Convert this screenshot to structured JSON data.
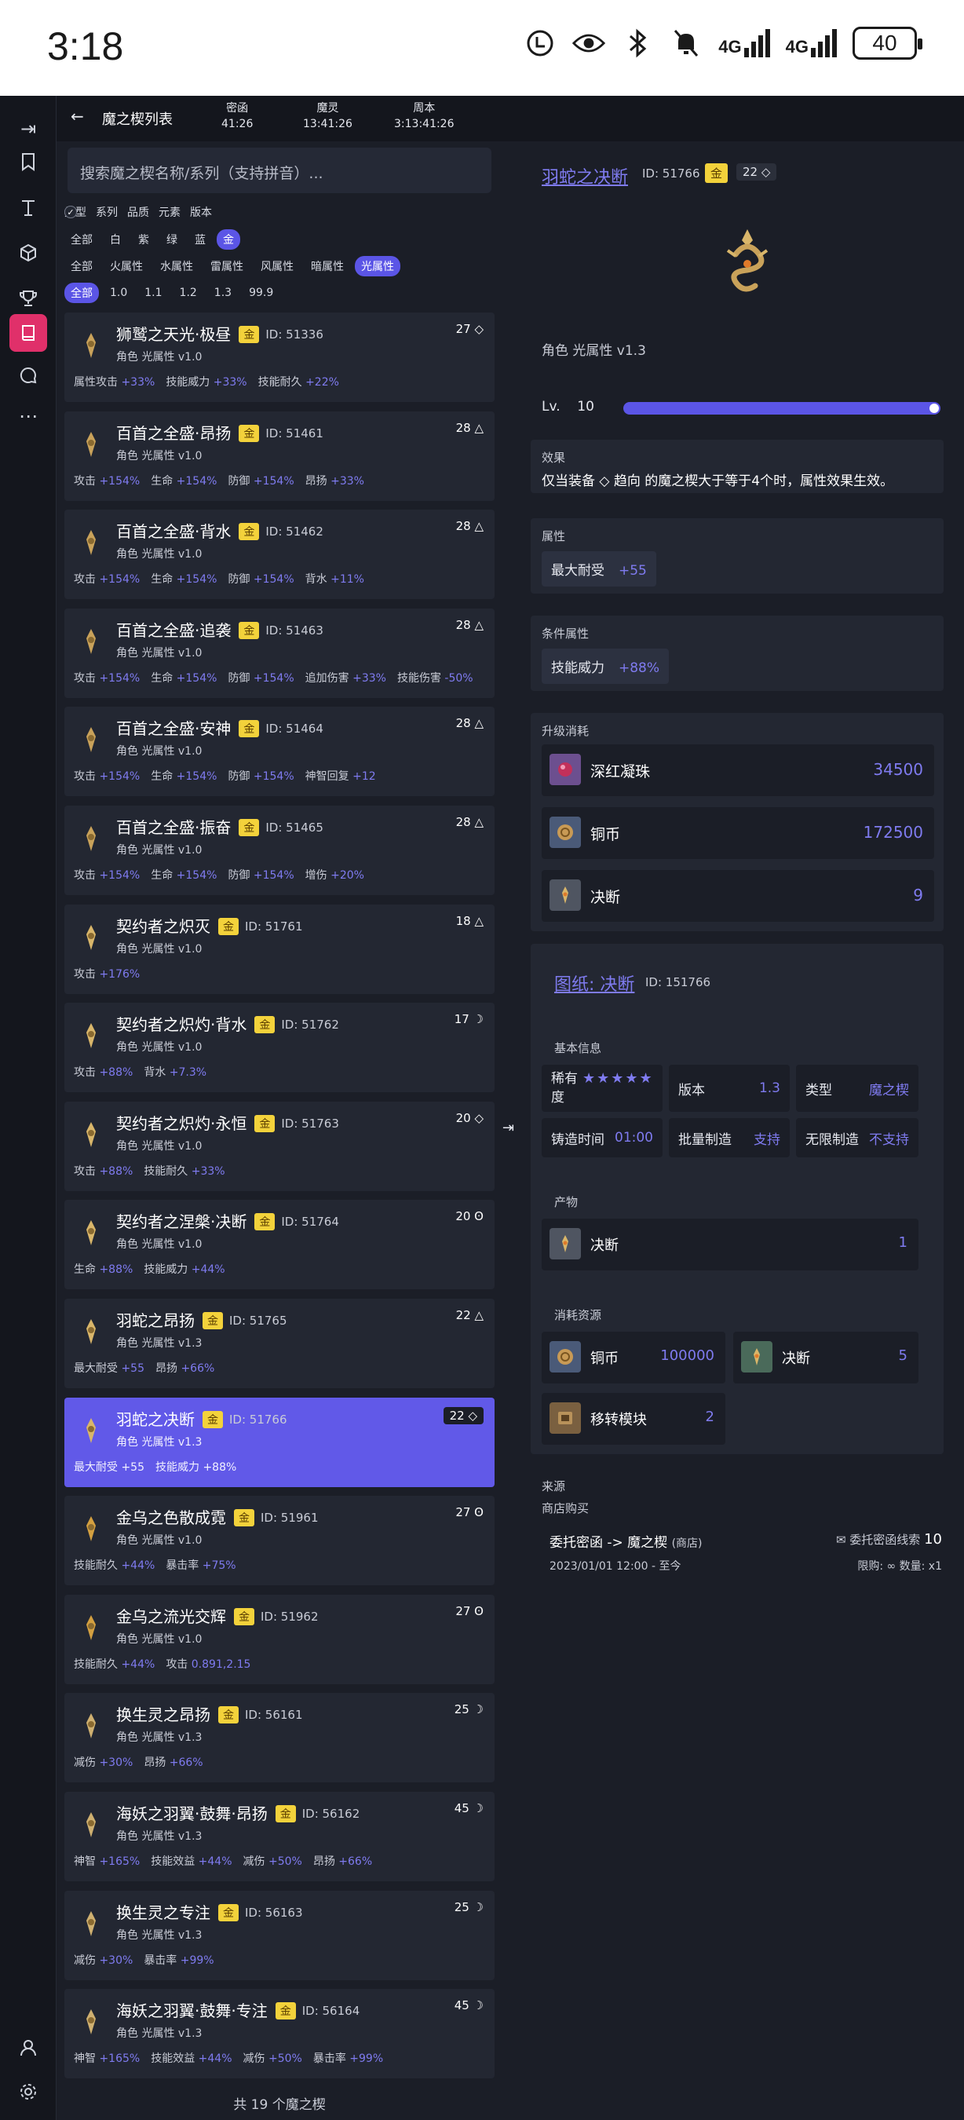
{
  "status": {
    "time": "3:18",
    "signal1": "4G",
    "signal2": "4G",
    "battery": "40"
  },
  "header": {
    "title": "魔之楔列表",
    "stats": [
      {
        "label": "密函",
        "value": "41:26"
      },
      {
        "label": "魔灵",
        "value": "13:41:26"
      },
      {
        "label": "周本",
        "value": "3:13:41:26"
      }
    ]
  },
  "search": {
    "placeholder": "搜索魔之楔名称/系列（支持拼音）..."
  },
  "filters": {
    "toggles": [
      "类型",
      "系列",
      "品质",
      "元素",
      "版本"
    ],
    "quality": [
      "全部",
      "白",
      "紫",
      "绿",
      "蓝",
      "金"
    ],
    "elements": [
      "全部",
      "火属性",
      "水属性",
      "雷属性",
      "风属性",
      "暗属性",
      "光属性"
    ],
    "versions": [
      "全部",
      "1.0",
      "1.1",
      "1.2",
      "1.3",
      "99.9"
    ]
  },
  "list": [
    {
      "name": "狮鹫之天光·极昼",
      "grade": "金",
      "id": "ID: 51336",
      "level": "27 ◇",
      "sub": "角色  光属性  v1.0",
      "stats": [
        [
          "属性攻击",
          "+33%"
        ],
        [
          "技能威力",
          "+33%"
        ],
        [
          "技能耐久",
          "+22%"
        ]
      ]
    },
    {
      "name": "百首之全盛·昂扬",
      "grade": "金",
      "id": "ID: 51461",
      "level": "28 △",
      "sub": "角色  光属性  v1.0",
      "stats": [
        [
          "攻击",
          "+154%"
        ],
        [
          "生命",
          "+154%"
        ],
        [
          "防御",
          "+154%"
        ],
        [
          "昂扬",
          "+33%"
        ]
      ]
    },
    {
      "name": "百首之全盛·背水",
      "grade": "金",
      "id": "ID: 51462",
      "level": "28 △",
      "sub": "角色  光属性  v1.0",
      "stats": [
        [
          "攻击",
          "+154%"
        ],
        [
          "生命",
          "+154%"
        ],
        [
          "防御",
          "+154%"
        ],
        [
          "背水",
          "+11%"
        ]
      ]
    },
    {
      "name": "百首之全盛·追袭",
      "grade": "金",
      "id": "ID: 51463",
      "level": "28 △",
      "sub": "角色  光属性  v1.0",
      "stats": [
        [
          "攻击",
          "+154%"
        ],
        [
          "生命",
          "+154%"
        ],
        [
          "防御",
          "+154%"
        ],
        [
          "追加伤害",
          "+33%"
        ],
        [
          "技能伤害",
          "-50%"
        ]
      ]
    },
    {
      "name": "百首之全盛·安神",
      "grade": "金",
      "id": "ID: 51464",
      "level": "28 △",
      "sub": "角色  光属性  v1.0",
      "stats": [
        [
          "攻击",
          "+154%"
        ],
        [
          "生命",
          "+154%"
        ],
        [
          "防御",
          "+154%"
        ],
        [
          "神智回复",
          "+12"
        ]
      ]
    },
    {
      "name": "百首之全盛·振奋",
      "grade": "金",
      "id": "ID: 51465",
      "level": "28 △",
      "sub": "角色  光属性  v1.0",
      "stats": [
        [
          "攻击",
          "+154%"
        ],
        [
          "生命",
          "+154%"
        ],
        [
          "防御",
          "+154%"
        ],
        [
          "增伤",
          "+20%"
        ]
      ]
    },
    {
      "name": "契约者之炽灭",
      "grade": "金",
      "id": "ID: 51761",
      "level": "18 △",
      "sub": "角色  光属性  v1.0",
      "stats": [
        [
          "攻击",
          "+176%"
        ]
      ]
    },
    {
      "name": "契约者之炽灼·背水",
      "grade": "金",
      "id": "ID: 51762",
      "level": "17 ☽",
      "sub": "角色  光属性  v1.0",
      "stats": [
        [
          "攻击",
          "+88%"
        ],
        [
          "背水",
          "+7.3%"
        ]
      ]
    },
    {
      "name": "契约者之炽灼·永恒",
      "grade": "金",
      "id": "ID: 51763",
      "level": "20 ◇",
      "sub": "角色  光属性  v1.0",
      "stats": [
        [
          "攻击",
          "+88%"
        ],
        [
          "技能耐久",
          "+33%"
        ]
      ]
    },
    {
      "name": "契约者之涅槃·决断",
      "grade": "金",
      "id": "ID: 51764",
      "level": "20 ʘ",
      "sub": "角色  光属性  v1.0",
      "stats": [
        [
          "生命",
          "+88%"
        ],
        [
          "技能威力",
          "+44%"
        ]
      ]
    },
    {
      "name": "羽蛇之昂扬",
      "grade": "金",
      "id": "ID: 51765",
      "level": "22 △",
      "sub": "角色  光属性  v1.3",
      "stats": [
        [
          "最大耐受",
          "+55"
        ],
        [
          "昂扬",
          "+66%"
        ]
      ]
    },
    {
      "name": "羽蛇之决断",
      "grade": "金",
      "id": "ID: 51766",
      "level": "22 ◇",
      "sub": "角色  光属性  v1.3",
      "stats": [
        [
          "最大耐受",
          "+55"
        ],
        [
          "技能威力",
          "+88%"
        ]
      ]
    },
    {
      "name": "金乌之色散成霓",
      "grade": "金",
      "id": "ID: 51961",
      "level": "27 ʘ",
      "sub": "角色  光属性  v1.0",
      "stats": [
        [
          "技能耐久",
          "+44%"
        ],
        [
          "暴击率",
          "+75%"
        ]
      ]
    },
    {
      "name": "金乌之流光交辉",
      "grade": "金",
      "id": "ID: 51962",
      "level": "27 ʘ",
      "sub": "角色  光属性  v1.0",
      "stats": [
        [
          "技能耐久",
          "+44%"
        ],
        [
          "攻击",
          "0.891,2.15"
        ]
      ]
    },
    {
      "name": "换生灵之昂扬",
      "grade": "金",
      "id": "ID: 56161",
      "level": "25 ☽",
      "sub": "角色  光属性  v1.3",
      "stats": [
        [
          "减伤",
          "+30%"
        ],
        [
          "昂扬",
          "+66%"
        ]
      ]
    },
    {
      "name": "海妖之羽翼·鼓舞·昂扬",
      "grade": "金",
      "id": "ID: 56162",
      "level": "45 ☽",
      "sub": "角色  光属性  v1.3",
      "stats": [
        [
          "神智",
          "+165%"
        ],
        [
          "技能效益",
          "+44%"
        ],
        [
          "减伤",
          "+50%"
        ],
        [
          "昂扬",
          "+66%"
        ]
      ]
    },
    {
      "name": "换生灵之专注",
      "grade": "金",
      "id": "ID: 56163",
      "level": "25 ☽",
      "sub": "角色  光属性  v1.3",
      "stats": [
        [
          "减伤",
          "+30%"
        ],
        [
          "暴击率",
          "+99%"
        ]
      ]
    },
    {
      "name": "海妖之羽翼·鼓舞·专注",
      "grade": "金",
      "id": "ID: 56164",
      "level": "45 ☽",
      "sub": "角色  光属性  v1.3",
      "stats": [
        [
          "神智",
          "+165%"
        ],
        [
          "技能效益",
          "+44%"
        ],
        [
          "减伤",
          "+50%"
        ],
        [
          "暴击率",
          "+99%"
        ]
      ]
    }
  ],
  "list_footer": "共 19 个魔之楔",
  "detail": {
    "title": "羽蛇之决断",
    "id": "ID: 51766",
    "grade": "金",
    "level": "22 ◇",
    "sub": "角色  光属性  v1.3",
    "lv_label": "Lv.",
    "lv_value": "10",
    "lv_fraction": 1.0,
    "effect_label": "效果",
    "effect_text": "仅当装备 ◇ 趋向 的魔之楔大于等于4个时，属性效果生效。",
    "attr_label": "属性",
    "attr_name": "最大耐受",
    "attr_value": "+55",
    "cond_label": "条件属性",
    "cond_name": "技能威力",
    "cond_value": "+88%",
    "upgrade_label": "升级消耗",
    "upgrade": [
      {
        "name": "深红凝珠",
        "value": "34500"
      },
      {
        "name": "铜币",
        "value": "172500"
      },
      {
        "name": "决断",
        "value": "9"
      }
    ]
  },
  "blueprint": {
    "title": "图纸: 决断",
    "id": "ID: 151766",
    "basic_label": "基本信息",
    "rarity_label": "稀有度",
    "rarity_stars": "★★★★★",
    "version_label": "版本",
    "version_value": "1.3",
    "type_label": "类型",
    "type_value": "魔之楔",
    "forge_time_label": "铸造时间",
    "forge_time_value": "01:00",
    "batch_label": "批量制造",
    "batch_value": "支持",
    "unlimited_label": "无限制造",
    "unlimited_value": "不支持",
    "product_label": "产物",
    "product_name": "决断",
    "product_value": "1",
    "consume_label": "消耗资源",
    "consume": [
      {
        "name": "铜币",
        "value": "100000"
      },
      {
        "name": "决断",
        "value": "5"
      },
      {
        "name": "移转模块",
        "value": "2"
      }
    ]
  },
  "source": {
    "label": "来源",
    "type": "商店购买",
    "path": "委托密函 -> 魔之楔",
    "path_note": "(商店)",
    "currency": "委托密函线索",
    "price": "10",
    "date": "2023/01/01 12:00 - 至今",
    "limit": "限购: ∞ 数量: x1"
  }
}
